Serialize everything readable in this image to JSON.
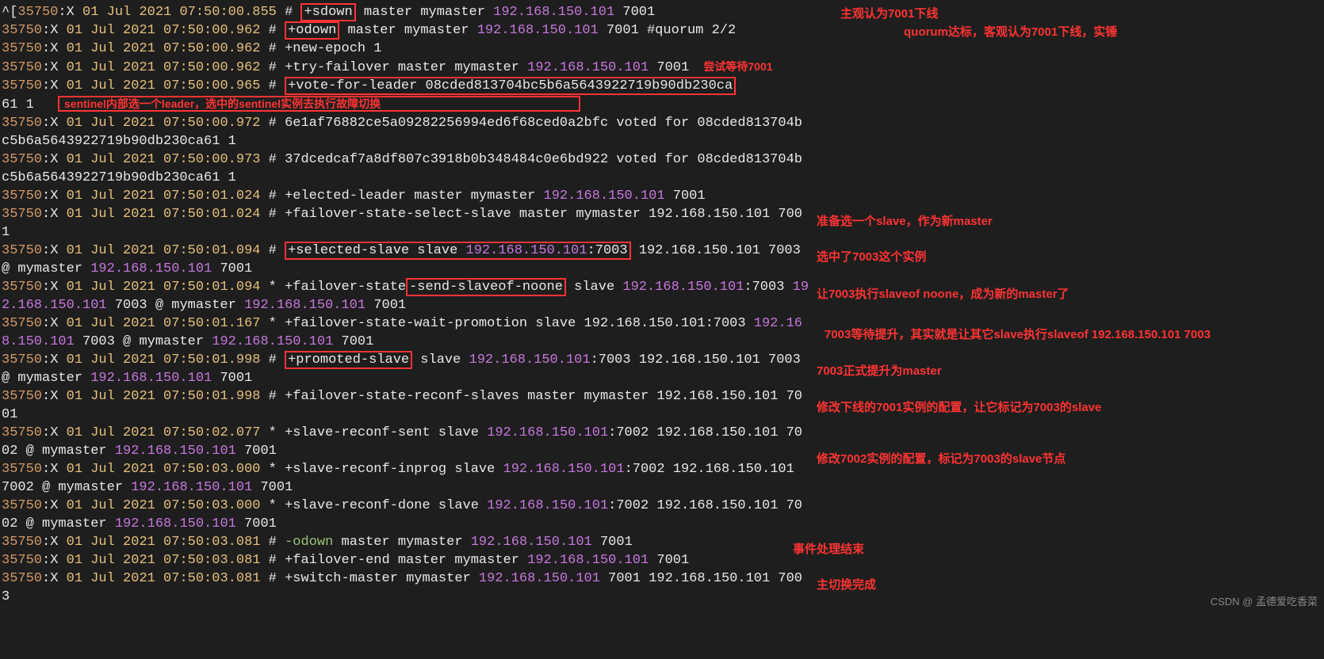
{
  "annotations": {
    "a1": "主观认为7001下线",
    "a2": "quorum达标，客观认为7001下线，实锤",
    "a3": "尝试等待7001",
    "a4": "sentinel内部选一个leader，选中的sentinel实例去执行故障切换",
    "a5": "准备选一个slave，作为新master",
    "a6": "选中了7003这个实例",
    "a7": "让7003执行slaveof noone，成为新的master了",
    "a8": "7003等待提升，其实就是让其它slave执行slaveof 192.168.150.101 7003",
    "a9": "7003正式提升为master",
    "a10": "修改下线的7001实例的配置，让它标记为7003的slave",
    "a11": "修改7002实例的配置，标记为7003的slave节点",
    "a12": "事件处理结束",
    "a13": "主切换完成"
  },
  "log": {
    "l1": {
      "caret": "^[",
      "pid": "35750",
      "role": ":X",
      "date": "01 Jul 2021",
      "time": "07:50:00.855",
      "sep": " # ",
      "event": "+sdown",
      "rest": " master mymaster ",
      "ip": "192.168.150.101",
      "after": " 7001"
    },
    "l2": {
      "pid": "35750",
      "role": ":X",
      "date": "01 Jul 2021",
      "time": "07:50:00.962",
      "sep": " # ",
      "event": "+odown",
      "rest": " master mymaster ",
      "ip": "192.168.150.101",
      "after": " 7001 #quorum 2/2"
    },
    "l3": {
      "pid": "35750",
      "role": ":X",
      "date": "01 Jul 2021",
      "time": "07:50:00.962",
      "sep": " # ",
      "rest": "+new-epoch 1"
    },
    "l4": {
      "pid": "35750",
      "role": ":X",
      "date": "01 Jul 2021",
      "time": "07:50:00.962",
      "sep": " # ",
      "rest": "+try-failover master mymaster ",
      "ip": "192.168.150.101",
      "after": " 7001"
    },
    "l5": {
      "pid": "35750",
      "role": ":X",
      "date": "01 Jul 2021",
      "time": "07:50:00.965",
      "sep": " # ",
      "event": "+vote-for-leader 08cded813704bc5b6a5643922719b90db230ca",
      "tail": "61 1"
    },
    "l6": {
      "pid": "35750",
      "role": ":X",
      "date": "01 Jul 2021",
      "time": "07:50:00.972",
      "sep": " # ",
      "rest": "6e1af76882ce5a09282256994ed6f68ced0a2bfc voted for 08cded813704bc5b6a5643922719b90db230ca61 1"
    },
    "l7": {
      "pid": "35750",
      "role": ":X",
      "date": "01 Jul 2021",
      "time": "07:50:00.973",
      "sep": " # ",
      "rest": "37dcedcaf7a8df807c3918b0b348484c0e6bd922 voted for 08cded813704bc5b6a5643922719b90db230ca61 1"
    },
    "l8": {
      "pid": "35750",
      "role": ":X",
      "date": "01 Jul 2021",
      "time": "07:50:01.024",
      "sep": " # ",
      "rest": "+elected-leader master mymaster ",
      "ip": "192.168.150.101",
      "after": " 7001"
    },
    "l9": {
      "pid": "35750",
      "role": ":X",
      "date": "01 Jul 2021",
      "time": "07:50:01.024",
      "sep": " # ",
      "rest": "+failover-state-select-slave master mymaster 192.168.150.101 7001"
    },
    "l10": {
      "pid": "35750",
      "role": ":X",
      "date": "01 Jul 2021",
      "time": "07:50:01.094",
      "sep": " # ",
      "event": "+selected-slave slave ",
      "ip": "192.168.150.101",
      "port": ":7003",
      "after": " 192.168.150.101 7003 @ mymaster ",
      "ip2": "192.168.150.101",
      "after2": " 7001"
    },
    "l11": {
      "pid": "35750",
      "role": ":X",
      "date": "01 Jul 2021",
      "time": "07:50:01.094",
      "sep": " * ",
      "pre": "+failover-state",
      "event": "-send-slaveof-noone",
      "after": " slave ",
      "ip": "192.168.150.101",
      "port": ":7003 ",
      "ip2": "192.168.150.101",
      "rest": " 7003 @ mymaster ",
      "ip3": "192.168.150.101",
      "after2": " 7001"
    },
    "l12": {
      "pid": "35750",
      "role": ":X",
      "date": "01 Jul 2021",
      "time": "07:50:01.167",
      "sep": " * ",
      "rest": "+failover-state-wait-promotion slave 192.168.150.101:7003 ",
      "ip": "192.168.150.101",
      "after": " 7003 @ mymaster ",
      "ip2": "192.168.150.101",
      "after2": " 7001"
    },
    "l13": {
      "pid": "35750",
      "role": ":X",
      "date": "01 Jul 2021",
      "time": "07:50:01.998",
      "sep": " # ",
      "event": "+promoted-slave",
      "after": " slave ",
      "ip": "192.168.150.101",
      "port": ":7003 192.168.150.101 7003 @ mymaster ",
      "ip2": "192.168.150.101",
      "after2": " 7001"
    },
    "l14": {
      "pid": "35750",
      "role": ":X",
      "date": "01 Jul 2021",
      "time": "07:50:01.998",
      "sep": " # ",
      "rest": "+failover-state-reconf-slaves master mymaster 192.168.150.101 7001"
    },
    "l15": {
      "pid": "35750",
      "role": ":X",
      "date": "01 Jul 2021",
      "time": "07:50:02.077",
      "sep": " * ",
      "rest": "+slave-reconf-sent slave ",
      "ip": "192.168.150.101",
      "port": ":7002 192.168.150.101 7002 @ mymaster ",
      "ip2": "192.168.150.101",
      "after": " 7001"
    },
    "l16": {
      "pid": "35750",
      "role": ":X",
      "date": "01 Jul 2021",
      "time": "07:50:03.000",
      "sep": " * ",
      "rest": "+slave-reconf-inprog slave ",
      "ip": "192.168.150.101",
      "port": ":7002 192.168.150.101 7002 @ mymaster ",
      "ip2": "192.168.150.101",
      "after": " 7001"
    },
    "l17": {
      "pid": "35750",
      "role": ":X",
      "date": "01 Jul 2021",
      "time": "07:50:03.000",
      "sep": " * ",
      "rest": "+slave-reconf-done slave ",
      "ip": "192.168.150.101",
      "port": ":7002 192.168.150.101 7002 @ mymaster ",
      "ip2": "192.168.150.101",
      "after": " 7001"
    },
    "l18": {
      "pid": "35750",
      "role": ":X",
      "date": "01 Jul 2021",
      "time": "07:50:03.081",
      "sep": " # ",
      "event": "-odown",
      "rest": " master mymaster ",
      "ip": "192.168.150.101",
      "after": " 7001"
    },
    "l19": {
      "pid": "35750",
      "role": ":X",
      "date": "01 Jul 2021",
      "time": "07:50:03.081",
      "sep": " # ",
      "rest": "+failover-end master mymaster ",
      "ip": "192.168.150.101",
      "after": " 7001"
    },
    "l20": {
      "pid": "35750",
      "role": ":X",
      "date": "01 Jul 2021",
      "time": "07:50:03.081",
      "sep": " # ",
      "rest": "+switch-master mymaster ",
      "ip": "192.168.150.101",
      "after": " 7001 192.168.150.101 7003"
    }
  },
  "watermark": "CSDN @ 孟德爱吃香菜"
}
